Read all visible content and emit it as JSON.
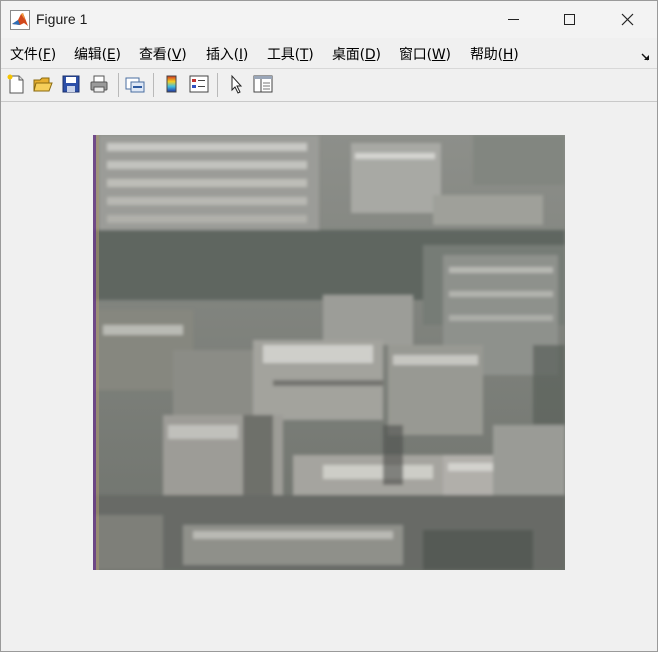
{
  "window": {
    "title": "Figure 1",
    "icon": "matlab-logo-icon"
  },
  "menubar": {
    "items": [
      {
        "label": "文件(",
        "key": "F",
        "tail": ")"
      },
      {
        "label": "编辑(",
        "key": "E",
        "tail": ")"
      },
      {
        "label": "查看(",
        "key": "V",
        "tail": ")"
      },
      {
        "label": "插入(",
        "key": "I",
        "tail": ")"
      },
      {
        "label": "工具(",
        "key": "T",
        "tail": ")"
      },
      {
        "label": "桌面(",
        "key": "D",
        "tail": ")"
      },
      {
        "label": "窗口(",
        "key": "W",
        "tail": ")"
      },
      {
        "label": "帮助(",
        "key": "H",
        "tail": ")"
      }
    ]
  },
  "toolbar": {
    "buttons": [
      "new-figure-icon",
      "open-file-icon",
      "save-icon",
      "print-icon",
      "link-plot-icon",
      "insert-colorbar-icon",
      "insert-legend-icon",
      "edit-plot-arrow-icon",
      "property-inspector-icon"
    ]
  },
  "figure": {
    "image_description_icon": "photo-image"
  }
}
